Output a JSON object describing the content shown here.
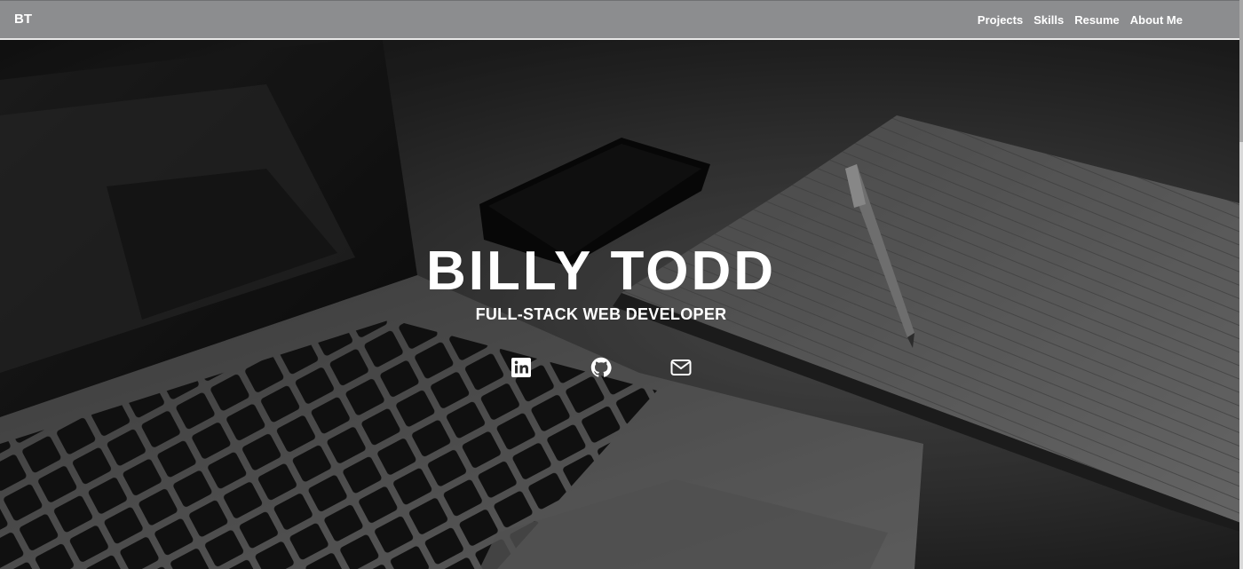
{
  "navbar": {
    "brand": "BT",
    "links": [
      {
        "label": "Projects"
      },
      {
        "label": "Skills"
      },
      {
        "label": "Resume"
      },
      {
        "label": "About Me"
      }
    ]
  },
  "hero": {
    "title": "BILLY TODD",
    "subtitle": "FULL-STACK WEB DEVELOPER",
    "background": "grayscale laptop-notebook-pen-phone desk photo"
  },
  "social": [
    {
      "icon": "linkedin-icon"
    },
    {
      "icon": "github-icon"
    },
    {
      "icon": "envelope-icon"
    }
  ],
  "colors": {
    "navbar_bg": "#8c8d8f",
    "text": "#ffffff"
  }
}
